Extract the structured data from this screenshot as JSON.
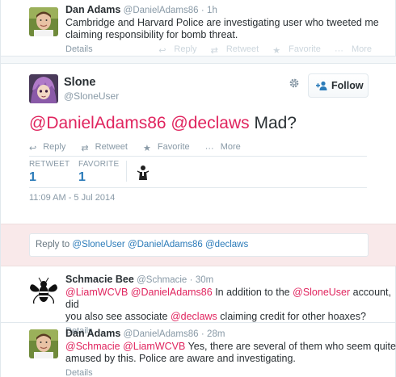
{
  "tweets_above": [
    {
      "name": "Dan Adams",
      "handle": "@DanielAdams86",
      "time": "1h",
      "text_line1": "Cambridge and Harvard Police are investigating user who tweeted me",
      "text_line2": "claiming responsibility for bomb threat.",
      "details": "Details"
    }
  ],
  "tweet_actions": {
    "reply": "Reply",
    "retweet": "Retweet",
    "favorite": "Favorite",
    "more": "More"
  },
  "permalink": {
    "name": "Slone",
    "handle": "@SloneUser",
    "follow_label": "Follow",
    "mention1": "@DanielAdams86",
    "mention2": "@declaws",
    "text_rest": "Mad?",
    "retweet_label": "RETWEET",
    "retweet_count": "1",
    "favorite_label": "FAVORITE",
    "favorite_count": "1",
    "timestamp": "11:09 AM - 5 Jul 2014"
  },
  "reply_box": {
    "prefix": "Reply to",
    "mentions": "@SloneUser @DanielAdams86 @declaws"
  },
  "replies": [
    {
      "name": "Schmacie Bee",
      "handle": "@Schmacie",
      "time": "30m",
      "m1": "@LiamWCVB",
      "m2": "@DanielAdams86",
      "t1": "In addition to the",
      "m3": "@SloneUser",
      "t2": "account, did",
      "t3": "you also see associate",
      "m4": "@declaws",
      "t4": "claiming credit for other hoaxes?",
      "details": "Details"
    },
    {
      "name": "Dan Adams",
      "handle": "@DanielAdams86",
      "time": "28m",
      "m1": "@Schmacie",
      "m2": "@LiamWCVB",
      "t1": "Yes, there are several of them who seem quite",
      "t2": "amused by this. Police are aware and investigating.",
      "details": "Details"
    }
  ],
  "colors": {
    "link": "#2b7bb9",
    "mention": "#e0245e",
    "muted": "#8899a6",
    "reply_band": "#f9e9ea"
  },
  "icons": [
    "reply-icon",
    "retweet-icon",
    "star-icon",
    "more-dots-icon",
    "gear-icon",
    "add-user-icon"
  ]
}
